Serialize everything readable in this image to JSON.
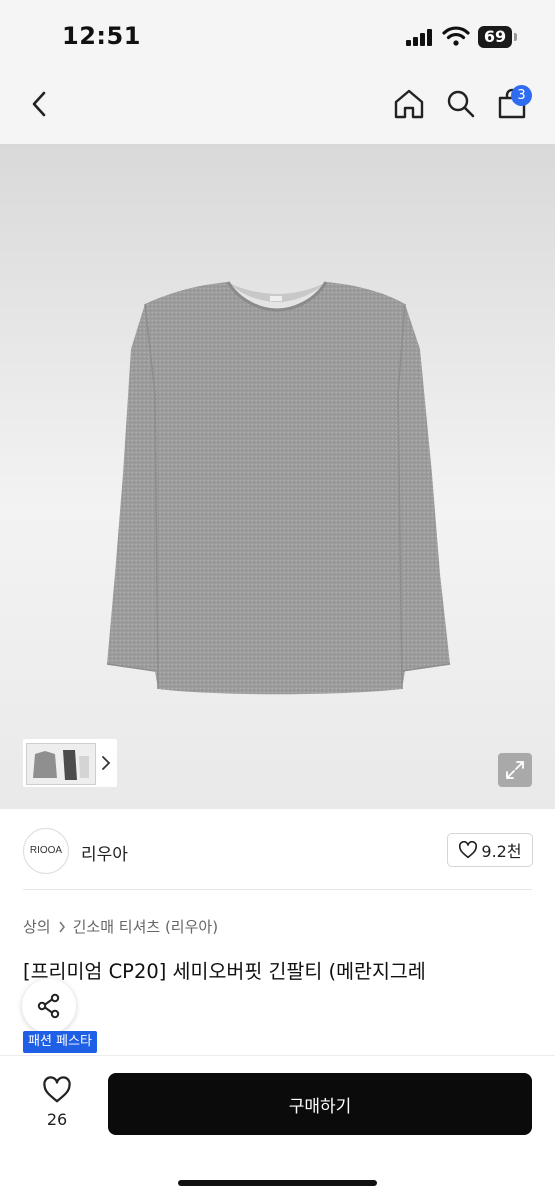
{
  "status_bar": {
    "time": "12:51",
    "battery": "69"
  },
  "nav": {
    "back_icon": "chevron-left-icon",
    "home_icon": "home-icon",
    "search_icon": "search-icon",
    "cart_icon": "shopping-bag-icon",
    "cart_count": "3"
  },
  "gallery": {
    "expand_icon": "expand-icon",
    "next_icon": "chevron-right-icon"
  },
  "seller": {
    "logo_text": "RIOOA",
    "name": "리우아",
    "likes": "9.2천"
  },
  "breadcrumb": {
    "category": "상의",
    "subcategory": "긴소매 티셔츠 (리우아)"
  },
  "product": {
    "title": "[프리미엄 CP20] 세미오버핏 긴팔티 (메란지그레",
    "promo_badge": "패션 페스타"
  },
  "bottom_bar": {
    "wish_count": "26",
    "buy_label": "구매하기"
  },
  "colors": {
    "accent": "#2f6cf2",
    "badge": "#1f5fe6",
    "buy_button": "#0b0b0b",
    "shirt": "#9c9c9c"
  }
}
